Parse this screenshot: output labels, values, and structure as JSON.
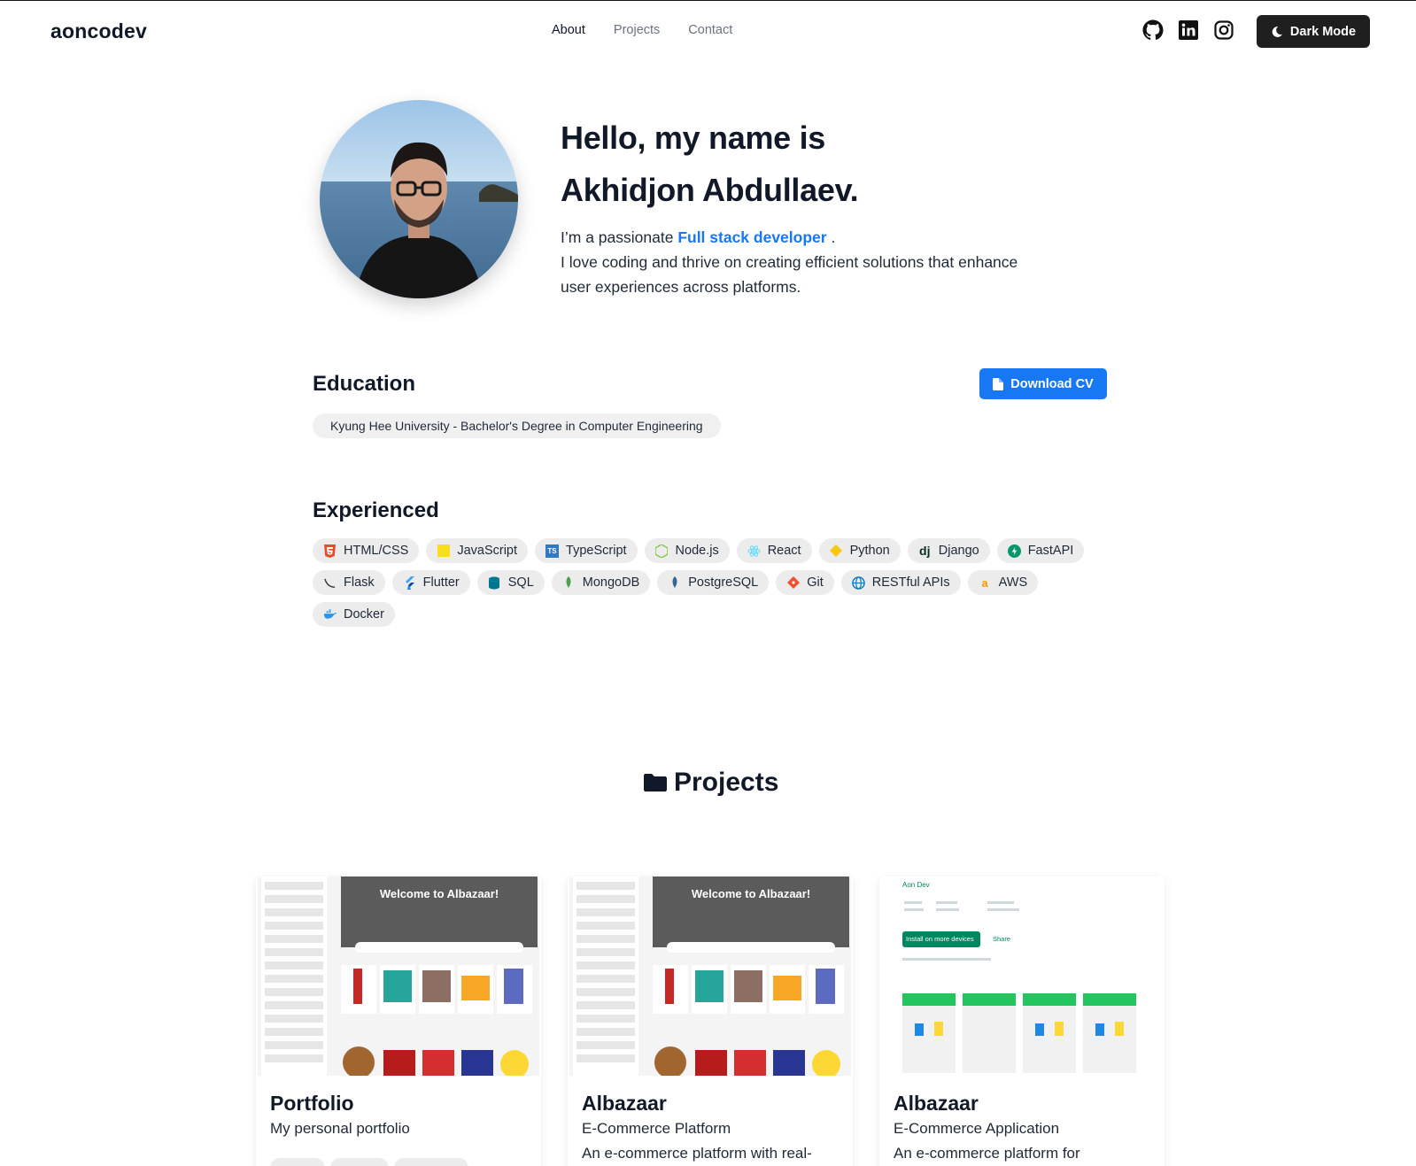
{
  "nav": {
    "brand": "aoncodev",
    "links": [
      "About",
      "Projects",
      "Contact"
    ],
    "dark_mode_label": "Dark Mode"
  },
  "hero": {
    "line1": "Hello, my name is",
    "line2": "Akhidjon Abdullaev.",
    "intro_prefix": "I’m a passionate",
    "intro_accent": "Full stack developer",
    "intro_suffix": ".",
    "body": "I love coding and thrive on creating efficient solutions that enhance user experiences across platforms."
  },
  "education": {
    "heading": "Education",
    "download_cv": "Download CV",
    "item": "Kyung Hee University - Bachelor's Degree in Computer Engineering"
  },
  "experienced": {
    "heading": "Experienced",
    "skills": [
      "HTML/CSS",
      "JavaScript",
      "TypeScript",
      "Node.js",
      "React",
      "Python",
      "Django",
      "FastAPI",
      "Flask",
      "Flutter",
      "SQL",
      "MongoDB",
      "PostgreSQL",
      "Git",
      "RESTful APIs",
      "AWS",
      "Docker"
    ]
  },
  "projects": {
    "heading": "Projects",
    "cards": [
      {
        "title": "Portfolio",
        "subtitle": "My personal portfolio",
        "description": "",
        "banner": "Welcome to Albazaar!"
      },
      {
        "title": "Albazaar",
        "subtitle": "E-Commerce Platform",
        "description": "An e-commerce platform with real-",
        "banner": "Welcome to Albazaar!"
      },
      {
        "title": "Albazaar",
        "subtitle": "E-Commerce Application",
        "description": "An e-commerce platform for",
        "store_dev": "Aon Dev",
        "install_label": "Install on more devices",
        "share_label": "Share"
      }
    ]
  },
  "colors": {
    "accent": "#1877f2",
    "dark_button": "#1f1f1f",
    "chip_bg": "#ececec"
  }
}
